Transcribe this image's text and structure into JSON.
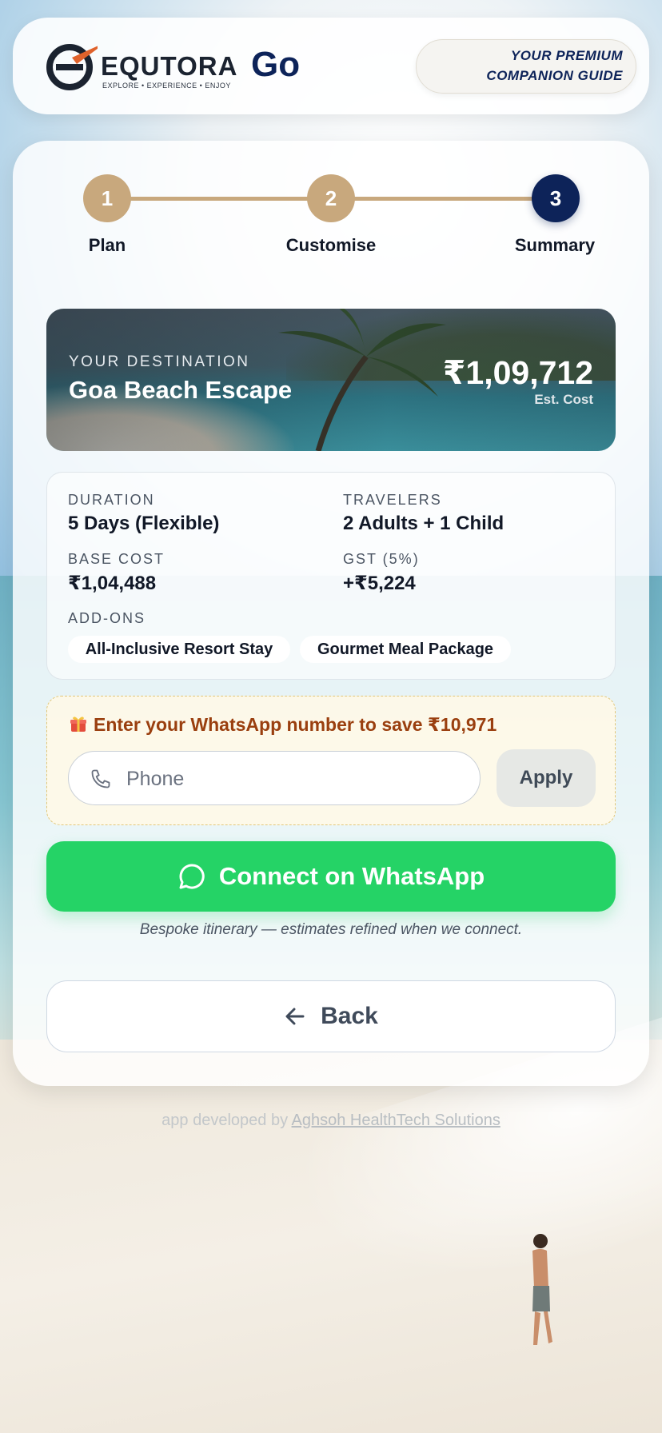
{
  "header": {
    "logo_text": "EQUTORA",
    "logo_tagline": "EXPLORE • EXPERIENCE • ENJOY",
    "app_name": "Go",
    "premium_line1": "YOUR PREMIUM",
    "premium_line2": "COMPANION GUIDE"
  },
  "stepper": {
    "steps": [
      {
        "number": "1",
        "label": "Plan",
        "state": "done"
      },
      {
        "number": "2",
        "label": "Customise",
        "state": "done"
      },
      {
        "number": "3",
        "label": "Summary",
        "state": "current"
      }
    ]
  },
  "destination": {
    "kicker": "YOUR DESTINATION",
    "name": "Goa Beach Escape",
    "price": "₹1,09,712",
    "price_note": "Est. Cost"
  },
  "details": {
    "duration_label": "DURATION",
    "duration_value": "5 Days (Flexible)",
    "travelers_label": "TRAVELERS",
    "travelers_value": "2 Adults + 1 Child",
    "base_cost_label": "BASE COST",
    "base_cost_value": "₹1,04,488",
    "gst_label": "GST (5%)",
    "gst_value": "+₹5,224",
    "addons_label": "ADD-ONS",
    "addons": [
      "All-Inclusive Resort Stay",
      "Gourmet Meal Package"
    ]
  },
  "promo": {
    "title": "Enter your WhatsApp number to save ₹10,971",
    "phone_placeholder": "Phone",
    "phone_value": "",
    "apply_label": "Apply"
  },
  "cta": {
    "whatsapp_label": "Connect on WhatsApp",
    "note": "Bespoke itinerary — estimates refined when we connect.",
    "back_label": "Back"
  },
  "footer": {
    "prefix": "app developed by ",
    "link": "Aghsoh HealthTech Solutions"
  },
  "colors": {
    "navy": "#0d2359",
    "gold": "#c8a87d",
    "whatsapp": "#25d366",
    "promo_text": "#9a3f0f"
  }
}
